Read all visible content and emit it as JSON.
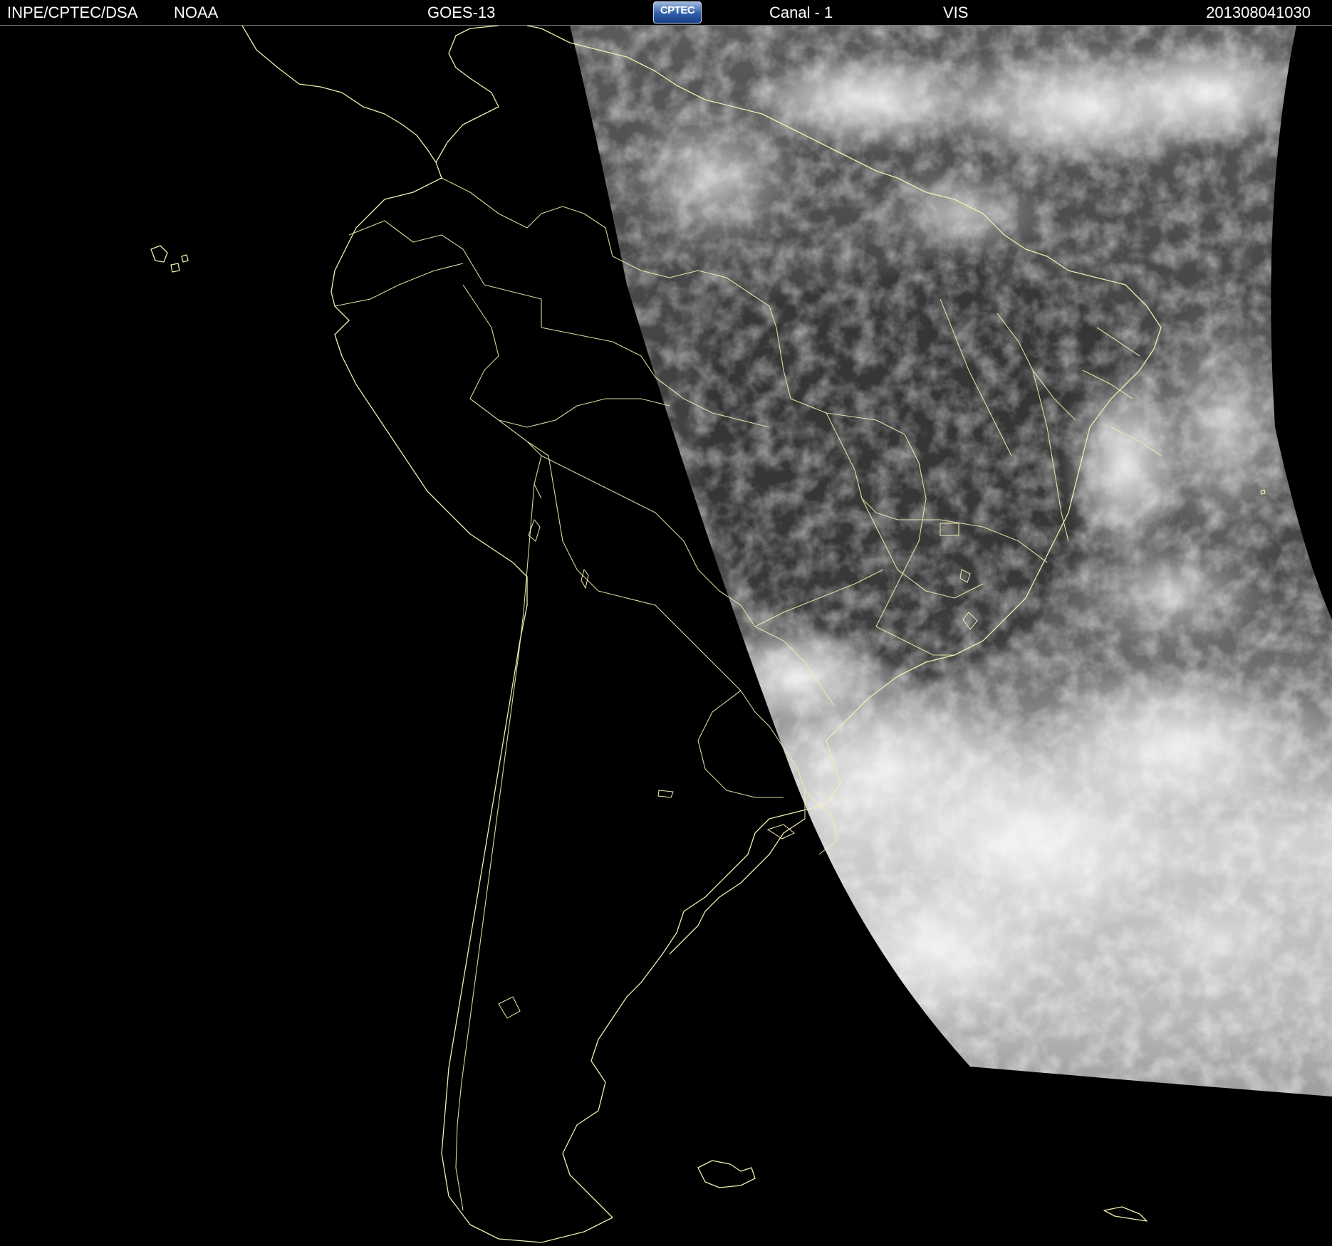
{
  "header": {
    "org": "INPE/CPTEC/DSA",
    "agency": "NOAA",
    "satellite": "GOES-13",
    "logo_text": "CPTEC",
    "channel": "Canal - 1",
    "band": "VIS",
    "datetime": "201308041030"
  },
  "colors": {
    "background": "#000000",
    "header_text": "#ffffff",
    "coastline": "#f2eeb0",
    "cloud": "#f4f4f4",
    "land_dark": "#3a3a3a"
  }
}
